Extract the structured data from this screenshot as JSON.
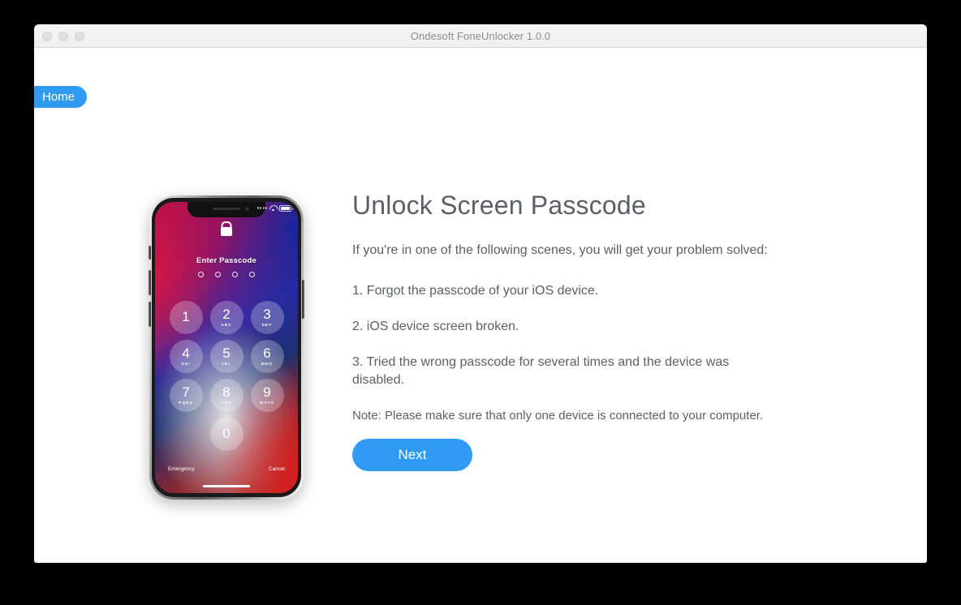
{
  "window": {
    "title": "Ondesoft FoneUnlocker 1.0.0",
    "traffic_lights": [
      "close",
      "minimize",
      "zoom"
    ]
  },
  "nav": {
    "home_label": "Home"
  },
  "page": {
    "headline": "Unlock Screen Passcode",
    "lead": "If you're in one of the following scenes, you will get your problem solved:",
    "scenes": [
      "1. Forgot the passcode of your iOS device.",
      "2. iOS device screen broken.",
      "3. Tried the wrong passcode for several times and the device was disabled."
    ],
    "note": "Note: Please make sure that only one device is connected to your computer.",
    "next_label": "Next"
  },
  "phone": {
    "passcode_label": "Enter Passcode",
    "dot_count": 4,
    "keys": [
      {
        "num": "1",
        "letters": ""
      },
      {
        "num": "2",
        "letters": "ABC"
      },
      {
        "num": "3",
        "letters": "DEF"
      },
      {
        "num": "4",
        "letters": "GHI"
      },
      {
        "num": "5",
        "letters": "JKL"
      },
      {
        "num": "6",
        "letters": "MNO"
      },
      {
        "num": "7",
        "letters": "PQRS"
      },
      {
        "num": "8",
        "letters": "TUV"
      },
      {
        "num": "9",
        "letters": "WXYZ"
      },
      {
        "num": "0",
        "letters": ""
      }
    ],
    "emergency_label": "Emergency",
    "cancel_label": "Cancel",
    "status_icons": [
      "signal-dots-icon",
      "wifi-icon",
      "battery-icon"
    ],
    "lock_icon": "lock-icon"
  },
  "colors": {
    "accent_blue": "#2f9bf4",
    "text_gray": "#5a6068",
    "title_gray": "#8d8d8d",
    "window_bg": "#ffffff",
    "desktop_bg": "#000000",
    "titlebar_bg": "#f3f3f3"
  }
}
